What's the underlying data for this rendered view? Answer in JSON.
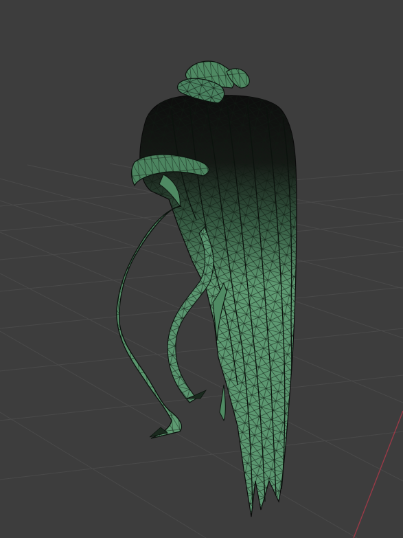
{
  "viewport": {
    "background_color": "#3d3d3d",
    "grid_line_color": "#4a4a4a",
    "x_axis_color": "#9a3a47",
    "mesh_fill_color": "#5e9a72",
    "mesh_shadow_color": "#141414",
    "wire_color": "#0f1a12",
    "object": "hair-mesh",
    "shading_mode": "wireframe-overlay"
  }
}
